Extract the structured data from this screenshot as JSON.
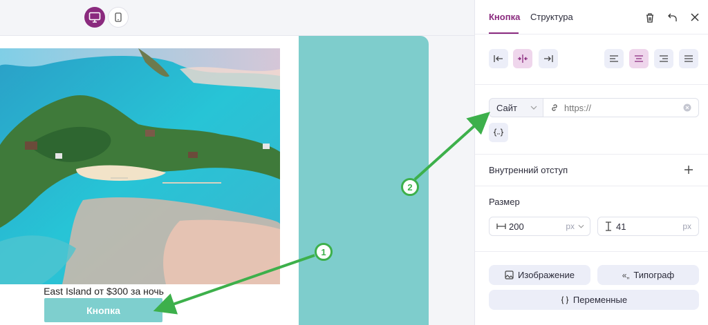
{
  "canvas": {
    "device_toggle": {
      "desktop_icon": "monitor-icon",
      "mobile_icon": "smartphone-icon"
    },
    "email": {
      "image_alt": "Aerial view of a tropical island",
      "caption": "East Island от $300 за ночь",
      "button_label": "Кнопка"
    }
  },
  "panel": {
    "tabs": [
      {
        "label": "Кнопка",
        "active": true
      },
      {
        "label": "Структура",
        "active": false
      }
    ],
    "header_icons": [
      "trash-icon",
      "undo-icon",
      "close-icon"
    ],
    "position_buttons": [
      "align-left-edge-icon",
      "align-center-icon",
      "align-right-edge-icon"
    ],
    "text_align_buttons": [
      "text-align-left-icon",
      "text-align-center-icon",
      "text-align-right-icon",
      "text-justify-icon"
    ],
    "link": {
      "type_value": "Сайт",
      "url_placeholder": "https://",
      "variables_icon": "braces-icon"
    },
    "padding": {
      "label": "Внутренний отступ"
    },
    "size": {
      "label": "Размер",
      "width": "200",
      "width_unit": "px",
      "height": "41",
      "height_unit": "px"
    },
    "bottom_buttons": {
      "image": "Изображение",
      "typograph": "Типограф",
      "variables": "Переменные"
    }
  },
  "annotations": {
    "badge_1": "1",
    "badge_2": "2"
  },
  "colors": {
    "brand": "#8a2a7e",
    "brand_light": "#efd6ec",
    "teal": "#7ecdcc",
    "button_bg": "#7ecfce",
    "annotation_green": "#3db04b",
    "chip_bg": "#eceef8"
  }
}
